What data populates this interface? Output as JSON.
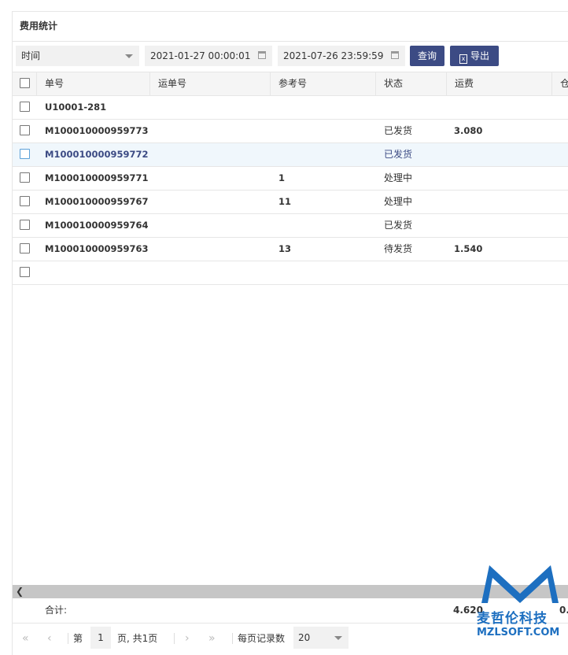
{
  "panel": {
    "title": "费用统计"
  },
  "toolbar": {
    "field_select": "时间",
    "date_start": "2021-01-27 00:00:01",
    "date_end": "2021-07-26 23:59:59",
    "query_label": "查询",
    "export_label": "导出"
  },
  "table": {
    "headers": [
      "单号",
      "运单号",
      "参考号",
      "状态",
      "运费",
      "仓"
    ],
    "rows": [
      {
        "no": "U10001-281",
        "waybill": "",
        "ref": "",
        "status": "",
        "fee": ""
      },
      {
        "no": "M100010000959773",
        "waybill": "",
        "ref": "",
        "status": "已发货",
        "fee": "3.080"
      },
      {
        "no": "M100010000959772",
        "waybill": "",
        "ref": "",
        "status": "已发货",
        "fee": ""
      },
      {
        "no": "M100010000959771",
        "waybill": "",
        "ref": "1",
        "status": "处理中",
        "fee": ""
      },
      {
        "no": "M100010000959767",
        "waybill": "",
        "ref": "11",
        "status": "处理中",
        "fee": ""
      },
      {
        "no": "M100010000959764",
        "waybill": "",
        "ref": "",
        "status": "已发货",
        "fee": ""
      },
      {
        "no": "M100010000959763",
        "waybill": "",
        "ref": "13",
        "status": "待发货",
        "fee": "1.540"
      },
      {
        "no": "",
        "waybill": "",
        "ref": "",
        "status": "",
        "fee": ""
      }
    ],
    "selected_row": 2
  },
  "footer": {
    "total_label": "合计:",
    "total_fee": "4.620",
    "total_next": "0."
  },
  "pager": {
    "prefix": "第",
    "page": "1",
    "suffix": "页, 共1页",
    "page_size_label": "每页记录数",
    "page_size": "20"
  },
  "watermark": {
    "cn": "麦哲伦科技",
    "en": "MZLSOFT.COM",
    "color": "#1d6fc0"
  },
  "colors": {
    "accent": "#3c4b84",
    "header_bg": "#f5f5f5",
    "selected_bg": "#f0f7fc"
  }
}
